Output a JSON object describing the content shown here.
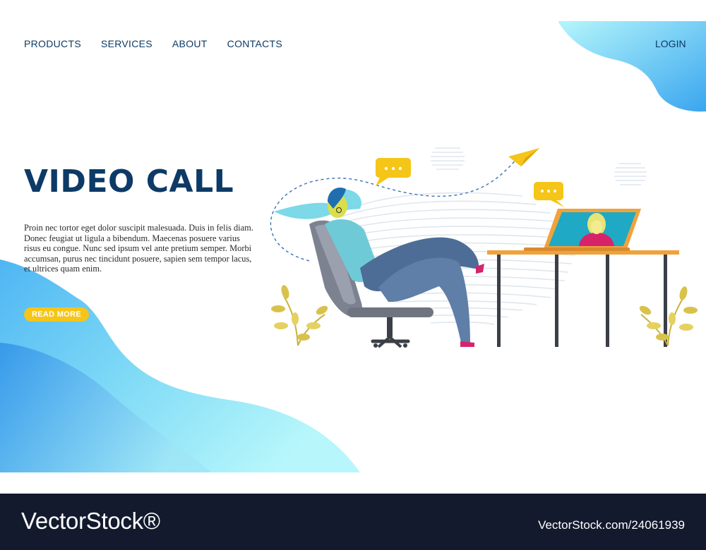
{
  "nav": {
    "items": [
      {
        "label": "PRODUCTS"
      },
      {
        "label": "SERVICES"
      },
      {
        "label": "ABOUT"
      },
      {
        "label": "CONTACTS"
      }
    ],
    "login": "LOGIN"
  },
  "hero": {
    "title": "VIDEO CALL",
    "body": "Proin nec tortor eget dolor suscipit malesuada. Duis in felis diam. Donec feugiat ut ligula a bibendum. Maecenas posuere varius risus eu congue. Nunc sed ipsum vel ante pretium semper. Morbi accumsan, purus nec tincidunt posuere, sapien sem tempor lacus, et ultrices quam enim.",
    "button": "READ MORE"
  },
  "illustration": {
    "icons": [
      "chat-bubble-icon",
      "paper-plane-icon",
      "laptop-icon",
      "office-chair-icon",
      "plant-icon"
    ]
  },
  "colors": {
    "primary": "#0d3a66",
    "accent": "#f5c518",
    "wave_light": "#a8f1fb",
    "wave_dark": "#3aa0ee",
    "footer": "#131a2e"
  },
  "watermark": {
    "logo": "VectorStock®",
    "id": "VectorStock.com/24061939"
  }
}
